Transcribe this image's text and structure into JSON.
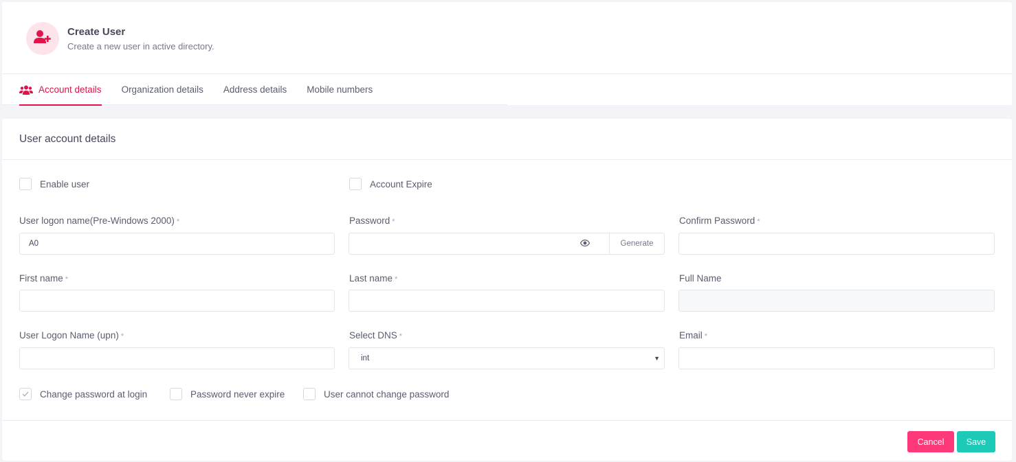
{
  "header": {
    "icon": "user-plus-icon",
    "title": "Create User",
    "subtitle": "Create a new user in active directory."
  },
  "tabs": [
    {
      "label": "Account details",
      "active": true,
      "icon": "users-icon"
    },
    {
      "label": "Organization details",
      "active": false
    },
    {
      "label": "Address details",
      "active": false
    },
    {
      "label": "Mobile numbers",
      "active": false
    }
  ],
  "form": {
    "section_title": "User account details",
    "top_checkboxes": [
      {
        "label": "Enable user",
        "checked": false
      },
      {
        "label": "Account Expire",
        "checked": false
      }
    ],
    "fields": {
      "logon_pre2000": {
        "label": "User logon name(Pre-Windows 2000)",
        "required": "*",
        "value": "A0"
      },
      "password": {
        "label": "Password",
        "required": "*",
        "value": "",
        "generate_label": "Generate",
        "toggle_icon": "eye-icon"
      },
      "confirm_password": {
        "label": "Confirm Password",
        "required": "*",
        "value": ""
      },
      "first_name": {
        "label": "First name",
        "required": "*",
        "value": ""
      },
      "last_name": {
        "label": "Last name",
        "required": "*",
        "value": ""
      },
      "full_name": {
        "label": "Full Name",
        "value": "",
        "disabled": true
      },
      "logon_upn": {
        "label": "User Logon Name (upn)",
        "required": "*",
        "value": ""
      },
      "dns": {
        "label": "Select DNS",
        "required": "*",
        "value": "int"
      },
      "email": {
        "label": "Email",
        "required": "*",
        "value": ""
      }
    },
    "bottom_checkboxes": [
      {
        "label": "Change password at login",
        "checked": true
      },
      {
        "label": "Password never expire",
        "checked": false
      },
      {
        "label": "User cannot change password",
        "checked": false
      }
    ]
  },
  "actions": {
    "cancel_label": "Cancel",
    "save_label": "Save"
  },
  "colors": {
    "accent": "#e0144b",
    "cancel": "#fd397a",
    "save": "#1dc9b7",
    "background": "#f3f3f8"
  }
}
